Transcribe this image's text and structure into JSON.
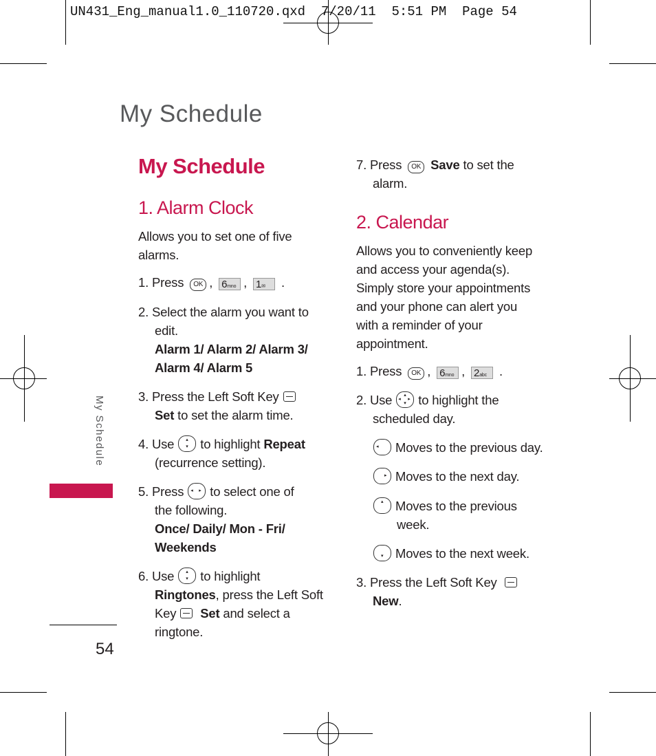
{
  "header_line": "UN431_Eng_manual1.0_110720.qxd  7/20/11  5:51 PM  Page 54",
  "running_title": "My Schedule",
  "side_tab": "My Schedule",
  "page_number": "54",
  "accent_color": "#c8174f",
  "title": "My Schedule",
  "alarm": {
    "heading": "1. Alarm Clock",
    "intro": [
      "Allows you to set one of five",
      "alarms."
    ],
    "s1": "1. Press",
    "s2": [
      "2. Select the alarm you want to",
      "edit.",
      "Alarm 1/ Alarm 2/ Alarm 3/",
      "Alarm 4/ Alarm 5"
    ],
    "s3": [
      "3. Press the Left Soft Key",
      "Set",
      " to set the alarm time."
    ],
    "s4": [
      "4. Use",
      "to highlight ",
      "Repeat",
      "(recurrence setting)."
    ],
    "s5": [
      "5. Press",
      "to select one of",
      "the following.",
      "Once/ Daily/ Mon - Fri/",
      "Weekends"
    ],
    "s6": [
      "6. Use",
      "to highlight",
      "Ringtones",
      ", press the Left Soft",
      "Key",
      "Set",
      " and select a",
      "ringtone."
    ]
  },
  "s7": [
    "7. Press",
    "Save",
    " to set the",
    "alarm."
  ],
  "calendar": {
    "heading": "2. Calendar",
    "intro": [
      "Allows you to conveniently keep",
      "and access your agenda(s).",
      "Simply store your appointments",
      "and your phone can alert you",
      "with a reminder of your",
      "appointment."
    ],
    "s1": "1. Press",
    "s2": [
      "2. Use",
      "to highlight the",
      "scheduled day."
    ],
    "moves": [
      "Moves to the previous day.",
      "Moves to the next day.",
      "Moves to the previous",
      "week.",
      "Moves to the next week."
    ],
    "s3": [
      "3. Press the Left Soft Key",
      "New",
      "."
    ]
  },
  "keys": {
    "ok": "OK",
    "six": "6",
    "six_sub": "mno",
    "one": "1",
    "two": "2",
    "two_sub": "abc",
    "comma": ",",
    "period": "."
  }
}
